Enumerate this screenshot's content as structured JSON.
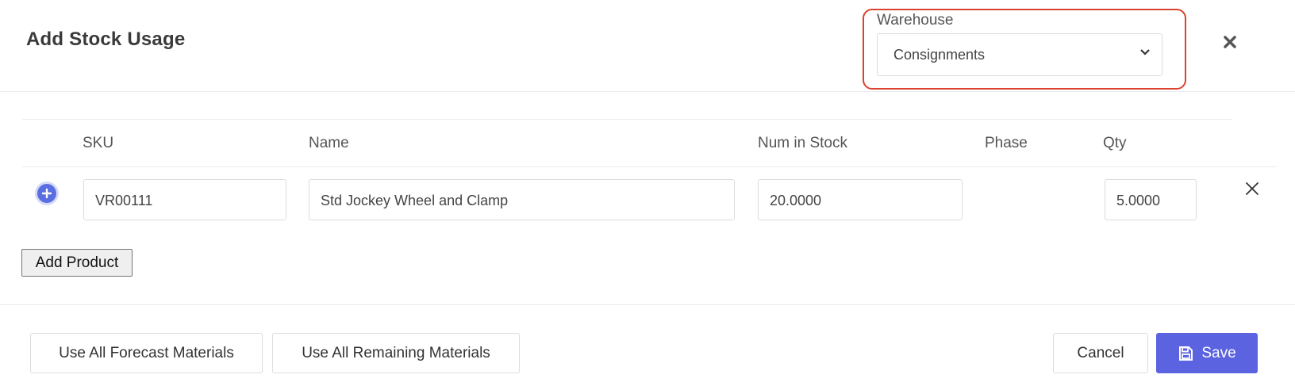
{
  "header": {
    "title": "Add Stock Usage",
    "close_icon": "close-icon"
  },
  "warehouse": {
    "label": "Warehouse",
    "selected": "Consignments"
  },
  "table": {
    "columns": [
      "SKU",
      "Name",
      "Num in Stock",
      "Phase",
      "Qty"
    ],
    "rows": [
      {
        "sku": "VR00111",
        "name": "Std Jockey Wheel and Clamp",
        "num_in_stock": "20.0000",
        "phase": "",
        "qty": "5.0000"
      }
    ]
  },
  "actions": {
    "add_product": "Add Product",
    "use_all_forecast": "Use All Forecast Materials",
    "use_all_remaining": "Use All Remaining Materials",
    "cancel": "Cancel",
    "save": "Save"
  },
  "colors": {
    "accent": "#5b63e0",
    "highlight": "#d9432f"
  }
}
